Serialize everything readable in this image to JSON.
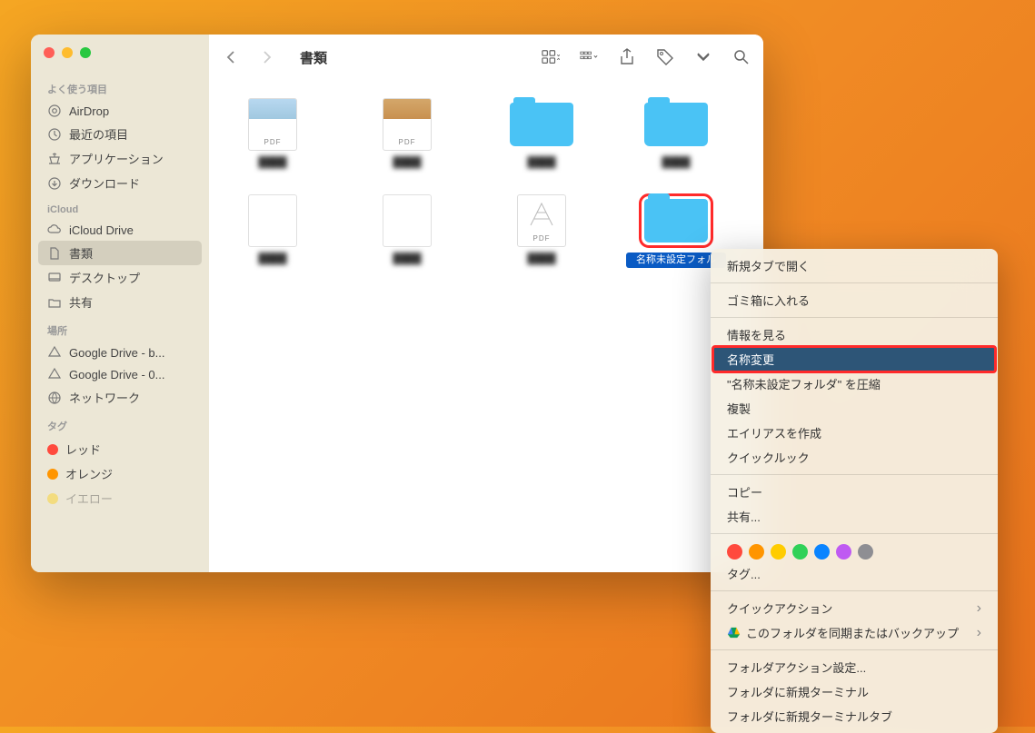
{
  "toolbar": {
    "title": "書類"
  },
  "sidebar": {
    "favorites_label": "よく使う項目",
    "favorites": [
      {
        "label": "AirDrop"
      },
      {
        "label": "最近の項目"
      },
      {
        "label": "アプリケーション"
      },
      {
        "label": "ダウンロード"
      }
    ],
    "icloud_label": "iCloud",
    "icloud": [
      {
        "label": "iCloud Drive"
      },
      {
        "label": "書類"
      },
      {
        "label": "デスクトップ"
      },
      {
        "label": "共有"
      }
    ],
    "locations_label": "場所",
    "locations": [
      {
        "label": "Google Drive - b..."
      },
      {
        "label": "Google Drive - 0..."
      },
      {
        "label": "ネットワーク"
      }
    ],
    "tags_label": "タグ",
    "tags": [
      {
        "label": "レッド",
        "color": "#ff4a3d"
      },
      {
        "label": "オレンジ",
        "color": "#ff9500"
      },
      {
        "label": "イエロー",
        "color": "#ffcc00"
      }
    ]
  },
  "files": [
    {
      "type": "pdf-blue",
      "name": "████"
    },
    {
      "type": "pdf-brown",
      "name": "████"
    },
    {
      "type": "folder",
      "name": "████"
    },
    {
      "type": "folder",
      "name": "████"
    },
    {
      "type": "blank",
      "name": "████"
    },
    {
      "type": "blank",
      "name": "████"
    },
    {
      "type": "pdf-web",
      "name": "████"
    },
    {
      "type": "folder",
      "name": "名称未設定フォル",
      "selected": true,
      "highlight": true
    }
  ],
  "context_menu": {
    "items": [
      {
        "label": "新規タブで開く"
      },
      {
        "sep": true
      },
      {
        "label": "ゴミ箱に入れる"
      },
      {
        "sep": true
      },
      {
        "label": "情報を見る"
      },
      {
        "label": "名称変更",
        "hover": true
      },
      {
        "label": "\"名称未設定フォルダ\" を圧縮"
      },
      {
        "label": "複製"
      },
      {
        "label": "エイリアスを作成"
      },
      {
        "label": "クイックルック"
      },
      {
        "sep": true
      },
      {
        "label": "コピー"
      },
      {
        "label": "共有..."
      },
      {
        "sep": true
      },
      {
        "tags": true
      },
      {
        "label": "タグ..."
      },
      {
        "sep": true
      },
      {
        "label": "クイックアクション",
        "sub": true
      },
      {
        "label": "このフォルダを同期またはバックアップ",
        "sub": true,
        "gdrive": true
      },
      {
        "sep": true
      },
      {
        "label": "フォルダアクション設定..."
      },
      {
        "label": "フォルダに新規ターミナル"
      },
      {
        "label": "フォルダに新規ターミナルタブ"
      }
    ],
    "tag_colors": [
      "#ff4a3d",
      "#ff9500",
      "#ffcc00",
      "#30d158",
      "#0a84ff",
      "#bf5af2",
      "#8e8e93"
    ]
  }
}
